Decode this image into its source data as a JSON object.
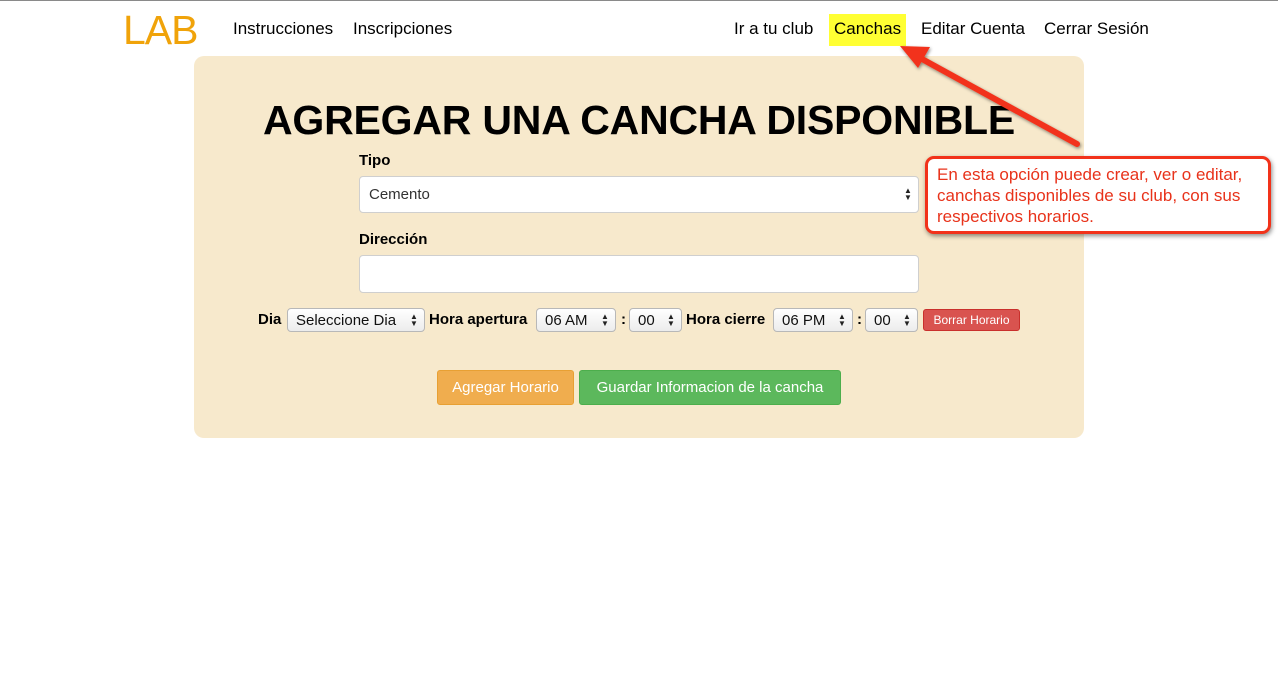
{
  "nav": {
    "brand": "LAB",
    "left_links": [
      "Instrucciones",
      "Inscripciones"
    ],
    "right_links": [
      "Ir a tu club",
      "Canchas",
      "Editar Cuenta",
      "Cerrar Sesión"
    ],
    "active_link": "Canchas",
    "active_highlight_color": "#ffff33",
    "brand_color": "#f0a30a"
  },
  "form": {
    "title": "AGREGAR UNA CANCHA DISPONIBLE",
    "tipo_label": "Tipo",
    "tipo_value": "Cemento",
    "direccion_label": "Dirección",
    "direccion_value": "",
    "schedule": {
      "dia_label": "Dia",
      "dia_value": "Seleccione Dia",
      "apertura_label": "Hora apertura",
      "apertura_hour": "06 AM",
      "apertura_min": "00",
      "cierre_label": "Hora cierre",
      "cierre_hour": "06 PM",
      "cierre_min": "00",
      "colon": ":",
      "delete_label": "Borrar Horario"
    },
    "add_schedule_label": "Agregar Horario",
    "save_label": "Guardar Informacion de la cancha",
    "panel_color": "#f7e9cc"
  },
  "annotation": {
    "text": "En esta opción puede crear, ver o editar, canchas disponibles de su club, con sus respectivos horarios.",
    "color": "#f2321a"
  }
}
